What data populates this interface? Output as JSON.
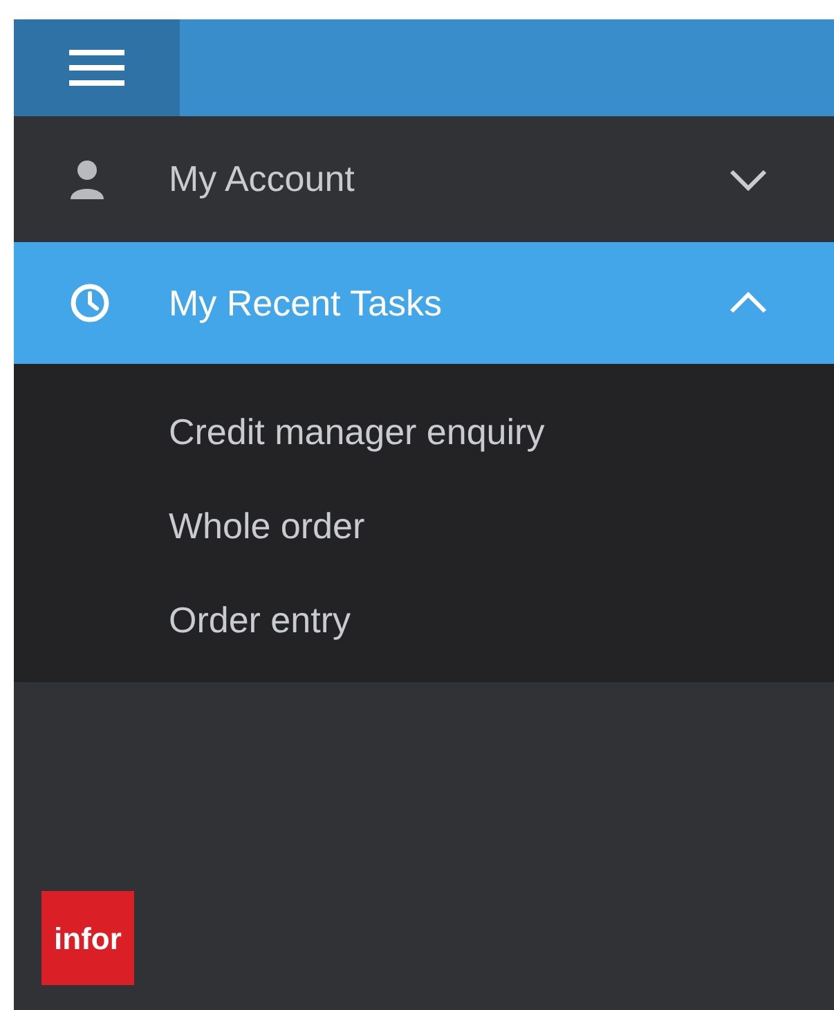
{
  "menu_items": [
    {
      "label": "My Account",
      "kind": "account",
      "expanded": false,
      "selected": false
    },
    {
      "label": "My Recent Tasks",
      "kind": "recent",
      "expanded": true,
      "selected": true,
      "children": [
        {
          "label": "Credit manager enquiry"
        },
        {
          "label": "Whole order"
        },
        {
          "label": "Order entry"
        }
      ]
    }
  ],
  "logo": {
    "text": "infor"
  }
}
